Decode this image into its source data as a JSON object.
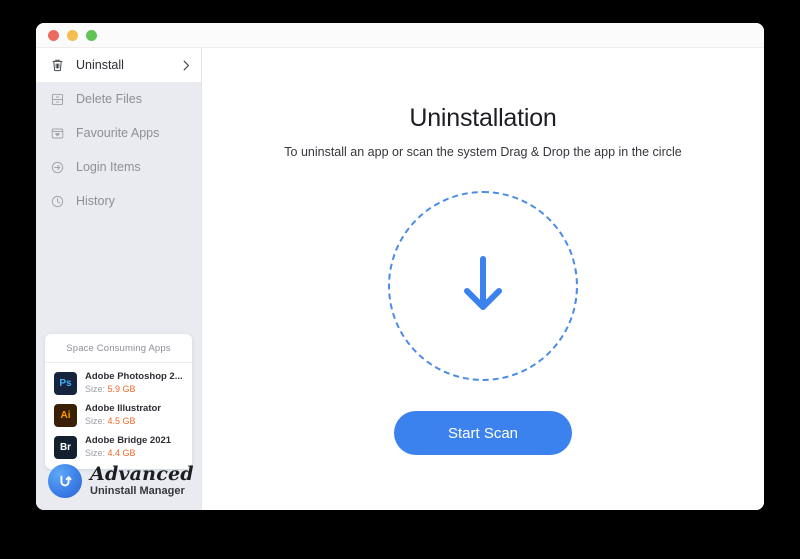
{
  "window": {
    "traffic_lights": [
      "close",
      "minimize",
      "maximize"
    ]
  },
  "sidebar": {
    "items": [
      {
        "label": "Uninstall",
        "icon": "trash-icon",
        "active": true,
        "chevron": "›"
      },
      {
        "label": "Delete Files",
        "icon": "file-drawer-icon",
        "active": false,
        "chevron": ""
      },
      {
        "label": "Favourite Apps",
        "icon": "window-heart-icon",
        "active": false,
        "chevron": ""
      },
      {
        "label": "Login Items",
        "icon": "login-arrow-icon",
        "active": false,
        "chevron": ""
      },
      {
        "label": "History",
        "icon": "clock-icon",
        "active": false,
        "chevron": ""
      }
    ],
    "space_card": {
      "title": "Space Consuming Apps",
      "size_label": "Size:",
      "apps": [
        {
          "name": "Adobe Photoshop 2...",
          "size": "5.9 GB",
          "badge": "Ps",
          "badge_bg": "#16243d",
          "badge_fg": "#45b3f6"
        },
        {
          "name": "Adobe Illustrator",
          "size": "4.5 GB",
          "badge": "Ai",
          "badge_bg": "#3a1f07",
          "badge_fg": "#ff9a00"
        },
        {
          "name": "Adobe Bridge 2021",
          "size": "4.4 GB",
          "badge": "Br",
          "badge_bg": "#12202f",
          "badge_fg": "#ffffff"
        }
      ]
    },
    "brand": {
      "title": "Advanced",
      "subtitle": "Uninstall Manager",
      "mark": "uninstall-logo-icon"
    }
  },
  "main": {
    "title": "Uninstallation",
    "subtitle": "To uninstall an app or scan the system Drag & Drop the app in the circle",
    "dropzone": {
      "icon": "download-arrow-icon"
    },
    "start_scan_label": "Start Scan"
  },
  "colors": {
    "accent": "#3b82ee",
    "dashed_border": "#4a8ce8",
    "size_value": "#f06a28",
    "sidebar_bg": "#e9ebf1"
  }
}
